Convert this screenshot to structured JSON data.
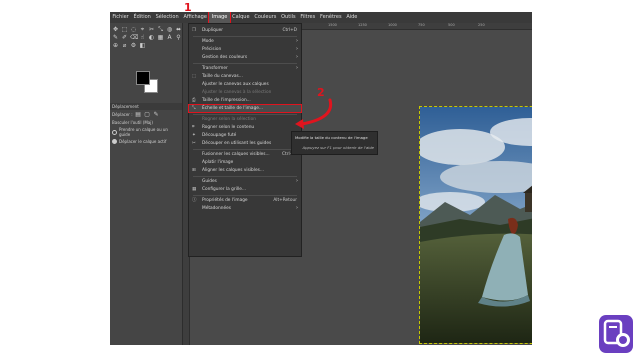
{
  "menubar": [
    "Fichier",
    "Édition",
    "Sélection",
    "Affichage",
    "Image",
    "Calque",
    "Couleurs",
    "Outils",
    "Filtres",
    "Fenêtres",
    "Aide"
  ],
  "menubar_active": "Image",
  "tool_options": {
    "title": "Déplacement",
    "mode_label": "Déplacer :",
    "toggle_label": "Basculer l'outil (Maj)",
    "option1": "Prendre un calque ou un guide",
    "option2": "Déplacer le calque actif"
  },
  "image_menu": [
    {
      "label": "Dupliquer",
      "shortcut": "Ctrl+D",
      "icon": "duplicate-icon"
    },
    {
      "sep": true
    },
    {
      "label": "Mode",
      "arrow": true
    },
    {
      "label": "Précision",
      "arrow": true
    },
    {
      "label": "Gestion des couleurs",
      "arrow": true
    },
    {
      "sep": true
    },
    {
      "label": "Transformer",
      "arrow": true
    },
    {
      "label": "Taille du canevas...",
      "icon": "canvas-size-icon"
    },
    {
      "label": "Ajuster le canevas aux calques"
    },
    {
      "label": "Ajuster le canevas à la sélection",
      "disabled": true
    },
    {
      "label": "Taille de l'impression...",
      "icon": "print-size-icon"
    },
    {
      "label": "Échelle et taille de l'image...",
      "icon": "scale-image-icon",
      "highlight": true
    },
    {
      "sep": true
    },
    {
      "label": "Rogner selon la sélection",
      "disabled": true
    },
    {
      "label": "Rogner selon le contenu",
      "icon": "crop-content-icon"
    },
    {
      "label": "Découpage futé",
      "icon": "zealous-crop-icon"
    },
    {
      "label": "Découper en utilisant les guides",
      "icon": "slice-guides-icon"
    },
    {
      "sep": true
    },
    {
      "label": "Fusionner les calques visibles...",
      "shortcut": "Ctrl+M"
    },
    {
      "label": "Aplatir l'image"
    },
    {
      "label": "Aligner les calques visibles...",
      "icon": "align-icon"
    },
    {
      "sep": true
    },
    {
      "label": "Guides",
      "arrow": true
    },
    {
      "label": "Configurer la grille...",
      "icon": "grid-icon"
    },
    {
      "sep": true
    },
    {
      "label": "Propriétés de l'image",
      "shortcut": "Alt+Retour",
      "icon": "info-icon"
    },
    {
      "label": "Métadonnées",
      "arrow": true
    }
  ],
  "tooltip": {
    "line1": "Modifie la taille du contenu de l'image",
    "line2": "Appuyez sur F1 pour obtenir de l'aide"
  },
  "ruler_ticks": [
    "1500",
    "1250",
    "1000",
    "750",
    "500",
    "250"
  ],
  "annotations": {
    "step1": "1",
    "step2": "2"
  },
  "colors": {
    "accent": "#e0141e",
    "menu_bg": "#383838",
    "window_bg": "#454545"
  }
}
